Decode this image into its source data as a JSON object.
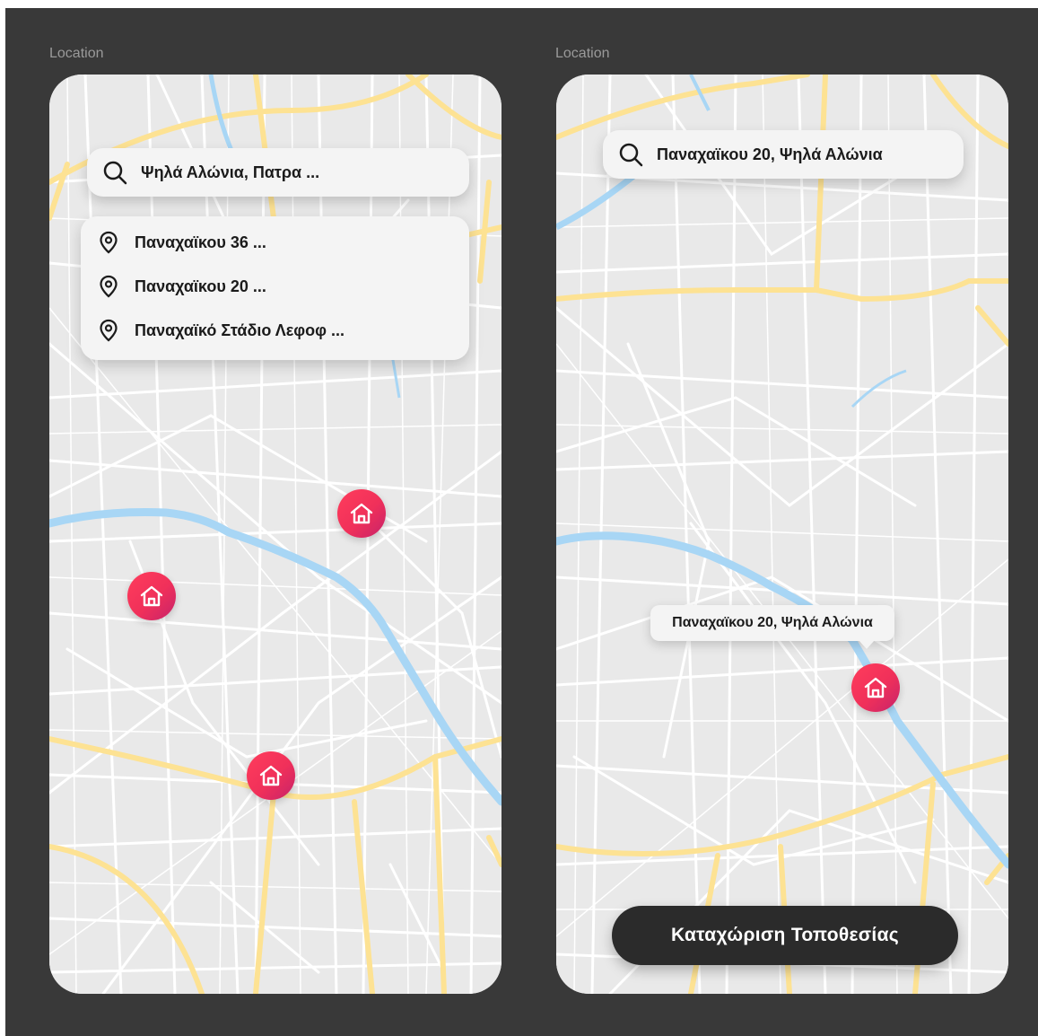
{
  "screens": [
    {
      "frame_label": "Location",
      "search_value": "Ψηλά Αλώνια, Πατρα ...",
      "suggestions": [
        {
          "label": "Παναχαϊκου 36 ...",
          "icon": "location-pin-icon"
        },
        {
          "label": "Παναχαϊκου 20 ...",
          "icon": "location-pin-icon"
        },
        {
          "label": "Παναχαϊκό Στάδιο Λεφοφ ...",
          "icon": "location-pin-icon"
        }
      ],
      "markers": [
        {
          "icon": "home-icon"
        },
        {
          "icon": "home-icon"
        },
        {
          "icon": "home-icon"
        }
      ]
    },
    {
      "frame_label": "Location",
      "search_value": "Παναχαϊκου 20, Ψηλά Αλώνια",
      "tooltip": "Παναχαϊκου 20, Ψηλά Αλώνια",
      "button_label": "Καταχώριση Τοποθεσίας"
    }
  ],
  "colors": {
    "background": "#393939",
    "map_land": "#e9e9e9",
    "map_street": "#ffffff",
    "map_major_road": "#fde293",
    "map_river": "#a8d6f5",
    "marker_start": "#ff3d5c",
    "marker_end": "#c6236a",
    "button": "#2b2b2b"
  }
}
